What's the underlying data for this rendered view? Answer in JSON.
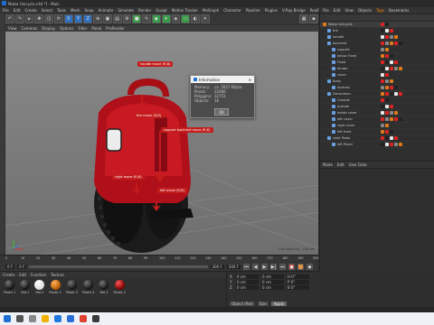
{
  "window": {
    "title": "Motor Unicycle.c4d *] - Main"
  },
  "menubar": {
    "items": [
      "File",
      "Edit",
      "Create",
      "Select",
      "Tools",
      "Mesh",
      "Snap",
      "Animate",
      "Simulate",
      "Render",
      "Sculpt",
      "Motion Tracker",
      "MoGraph",
      "Character",
      "Pipeline",
      "Plugins",
      "V-Ray Bridge",
      "RealFlow",
      "Script",
      "Window",
      "Help"
    ],
    "highlight": "Window"
  },
  "viewport": {
    "menu": [
      "View",
      "Cameras",
      "Display",
      "Options",
      "Filter",
      "Panel",
      "ProRender"
    ],
    "grid_label": "Grid Spacing : 100 cm",
    "annotations": {
      "handle": "handle move (R,B)",
      "tire": "tire move (R,R)",
      "support": "support backrest move (R,B)",
      "right": "right move (R,B)",
      "left": "left move (R,B)"
    }
  },
  "info_dialog": {
    "title": "Information",
    "rows": [
      {
        "k": "Memory:",
        "v": "ca. 2657 KByte"
      },
      {
        "k": "Points:",
        "v": "32466"
      },
      {
        "k": "Polygons:",
        "v": "32751"
      },
      {
        "k": "Objects:",
        "v": "16"
      }
    ],
    "ok": "OK"
  },
  "object_manager": {
    "menu": [
      "File",
      "Edit",
      "View",
      "Objects",
      "Tags",
      "Bookmarks"
    ],
    "highlight": "Tags",
    "objects": [
      {
        "name": "Motor Unicycle",
        "indent": 0
      },
      {
        "name": "tire",
        "indent": 1
      },
      {
        "name": "handle",
        "indent": 1
      },
      {
        "name": "backrest",
        "indent": 1
      },
      {
        "name": "support",
        "indent": 2
      },
      {
        "name": "below Fixed",
        "indent": 2
      },
      {
        "name": "Fixed",
        "indent": 2
      },
      {
        "name": "fender",
        "indent": 2
      },
      {
        "name": "cover",
        "indent": 2
      },
      {
        "name": "Body",
        "indent": 1
      },
      {
        "name": "footrest",
        "indent": 2
      },
      {
        "name": "Decoration",
        "indent": 1
      },
      {
        "name": "Outside",
        "indent": 2
      },
      {
        "name": "outside",
        "indent": 2
      },
      {
        "name": "inside cover",
        "indent": 2
      },
      {
        "name": "left cover",
        "indent": 2
      },
      {
        "name": "right cover",
        "indent": 2
      },
      {
        "name": "left front",
        "indent": 2
      },
      {
        "name": "right Pedal",
        "indent": 1
      },
      {
        "name": "left Pedal",
        "indent": 2
      }
    ]
  },
  "attributes": {
    "menu": [
      "Mode",
      "Edit",
      "User Data"
    ]
  },
  "timeline": {
    "ticks": [
      "0",
      "10",
      "20",
      "30",
      "40",
      "50",
      "60",
      "70",
      "80",
      "90",
      "100",
      "110",
      "120",
      "130",
      "140",
      "150",
      "160",
      "170",
      "180",
      "190",
      "200"
    ],
    "start": "0 F",
    "current": "0 F",
    "end": "200 F",
    "end2": "200 F",
    "frame_display": "0 F"
  },
  "materials": {
    "menu": [
      "Create",
      "Edit",
      "Function",
      "Texture"
    ],
    "items": [
      "Plastic 1",
      "Mat.1",
      "Mat.2",
      "Plastic 2",
      "Plastic 3",
      "Plastic 4",
      "Mat.3",
      "Plastic 5"
    ]
  },
  "coords": {
    "rows": [
      {
        "axis": "X",
        "pos": "0 cm",
        "size": "0 cm",
        "rot": "H 0°"
      },
      {
        "axis": "Y",
        "pos": "0 cm",
        "size": "0 cm",
        "rot": "P 0°"
      },
      {
        "axis": "Z",
        "pos": "0 cm",
        "size": "0 cm",
        "rot": "B 0°"
      }
    ],
    "object_label": "Object (Rel)",
    "size_label": "Size",
    "apply": "Apply"
  },
  "colors": {
    "accent": "#ff8a00",
    "annotation": "#c41c1c",
    "body_red": "#b0101a",
    "selection": "#2f6fbf"
  }
}
